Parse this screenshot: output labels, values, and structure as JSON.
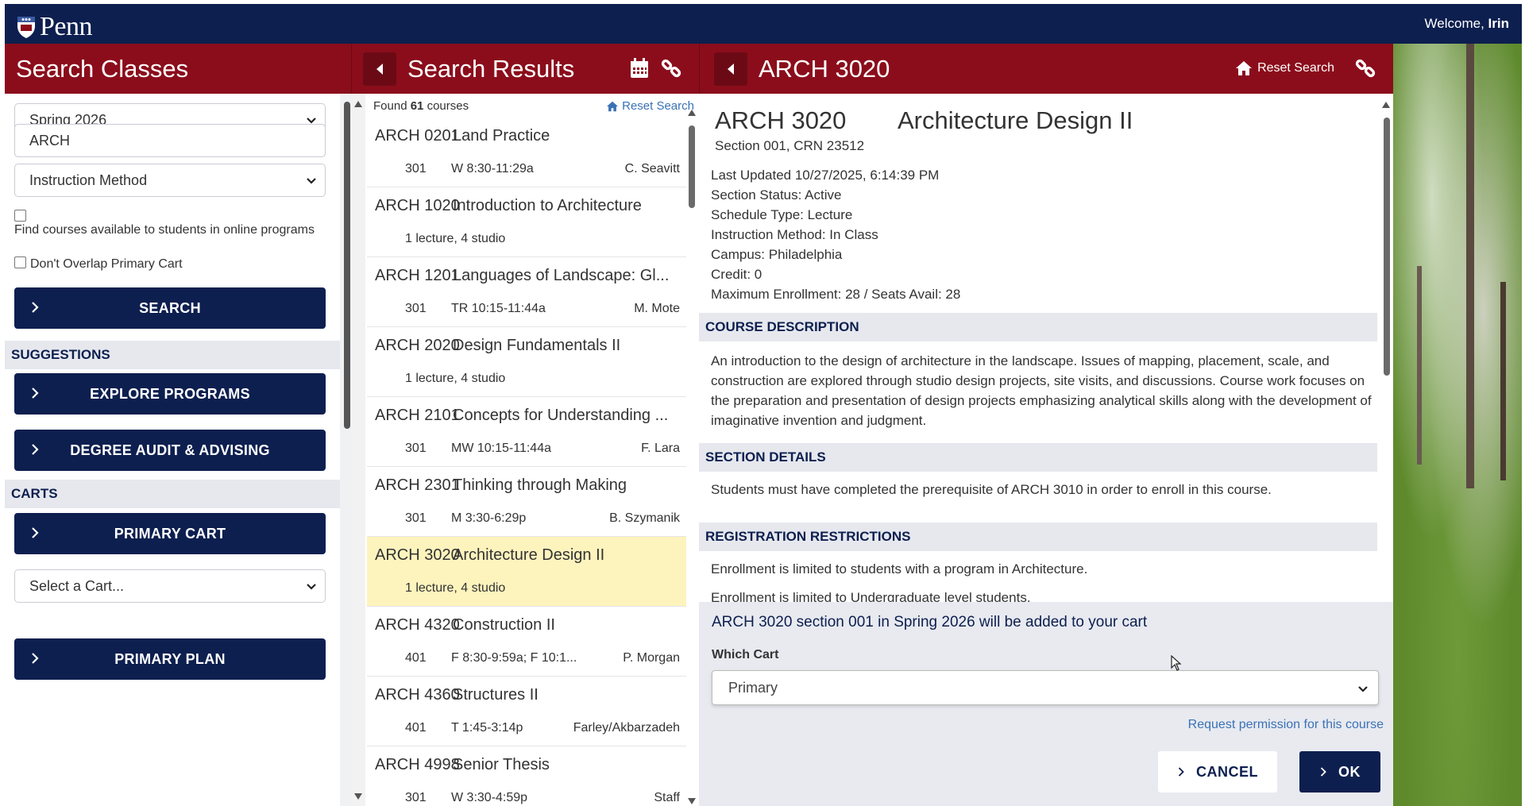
{
  "header": {
    "logo_text": "Penn",
    "welcome_prefix": "Welcome,",
    "welcome_name": "Irin"
  },
  "left_panel": {
    "title": "Search Classes",
    "term_select": "Spring 2026",
    "subject_input": "ARCH",
    "instruction_method_select": "Instruction Method",
    "online_checkbox_label": "Find courses available to students in online programs",
    "overlap_checkbox_label": "Don't Overlap Primary Cart",
    "search_button": "SEARCH",
    "suggestions_label": "SUGGESTIONS",
    "explore_button": "EXPLORE PROGRAMS",
    "degree_button": "DEGREE AUDIT & ADVISING",
    "carts_label": "CARTS",
    "primary_cart_button": "PRIMARY CART",
    "cart_select": "Select a Cart...",
    "primary_plan_button": "PRIMARY PLAN"
  },
  "middle_panel": {
    "title": "Search Results",
    "found_prefix": "Found",
    "found_count": "61",
    "found_suffix": "courses",
    "reset_label": "Reset Search",
    "results": [
      {
        "code": "ARCH 0201",
        "title": "Land Practice",
        "section": "301",
        "time": "W 8:30-11:29a",
        "instructor": "C. Seavitt",
        "schedule": ""
      },
      {
        "code": "ARCH 1020",
        "title": "Introduction to Architecture",
        "section": "",
        "time": "",
        "instructor": "",
        "schedule": "1 lecture, 4 studio"
      },
      {
        "code": "ARCH 1201",
        "title": "Languages of Landscape: Gl...",
        "section": "301",
        "time": "TR 10:15-11:44a",
        "instructor": "M. Mote",
        "schedule": ""
      },
      {
        "code": "ARCH 2020",
        "title": "Design Fundamentals II",
        "section": "",
        "time": "",
        "instructor": "",
        "schedule": "1 lecture, 4 studio"
      },
      {
        "code": "ARCH 2101",
        "title": "Concepts for Understanding ...",
        "section": "301",
        "time": "MW 10:15-11:44a",
        "instructor": "F. Lara",
        "schedule": ""
      },
      {
        "code": "ARCH 2301",
        "title": "Thinking through Making",
        "section": "301",
        "time": "M 3:30-6:29p",
        "instructor": "B. Szymanik",
        "schedule": ""
      },
      {
        "code": "ARCH 3020",
        "title": "Architecture Design II",
        "section": "",
        "time": "",
        "instructor": "",
        "schedule": "1 lecture, 4 studio"
      },
      {
        "code": "ARCH 4320",
        "title": "Construction II",
        "section": "401",
        "time": "F 8:30-9:59a; F 10:1...",
        "instructor": "P. Morgan",
        "schedule": ""
      },
      {
        "code": "ARCH 4360",
        "title": "Structures II",
        "section": "401",
        "time": "T 1:45-3:14p",
        "instructor": "Farley/Akbarzadeh",
        "schedule": ""
      },
      {
        "code": "ARCH 4998",
        "title": "Senior Thesis",
        "section": "301",
        "time": "W 3:30-4:59p",
        "instructor": "Staff",
        "schedule": ""
      }
    ]
  },
  "right_panel": {
    "header_title": "ARCH 3020",
    "reset_label": "Reset Search",
    "course_code": "ARCH 3020",
    "course_title": "Architecture Design II",
    "section_line": "Section 001, CRN 23512",
    "last_updated": "Last Updated 10/27/2025, 6:14:39 PM",
    "section_status": "Section Status: Active",
    "schedule_type": "Schedule Type: Lecture",
    "instruction_method": "Instruction Method: In Class",
    "campus": "Campus: Philadelphia",
    "credit": "Credit: 0",
    "enrollment": "Maximum Enrollment: 28 / Seats Avail: 28",
    "course_description_label": "COURSE DESCRIPTION",
    "course_description": "An introduction to the design of architecture in the landscape. Issues of mapping, placement, scale, and construction are explored through studio design projects, site visits, and discussions. Course work focuses on the preparation and presentation of design projects emphasizing analytical skills along with the development of imaginative invention and judgment.",
    "section_details_label": "SECTION DETAILS",
    "section_details": "Students must have completed the prerequisite of ARCH 3010 in order to enroll in this course.",
    "restrictions_label": "REGISTRATION RESTRICTIONS",
    "restriction_1": "Enrollment is limited to students with a program in Architecture.",
    "restriction_2": "Enrollment is limited to Undergraduate level students."
  },
  "cart_dialog": {
    "message": "ARCH 3020 section 001 in Spring 2026 will be added to your cart",
    "which_cart_label": "Which Cart",
    "cart_value": "Primary",
    "permission_link": "Request permission for this course",
    "cancel_label": "CANCEL",
    "ok_label": "OK"
  },
  "colors": {
    "navy": "#0d1f4f",
    "crimson": "#8b0d1b",
    "highlight": "#fdf3bd",
    "link": "#3a72b5"
  }
}
